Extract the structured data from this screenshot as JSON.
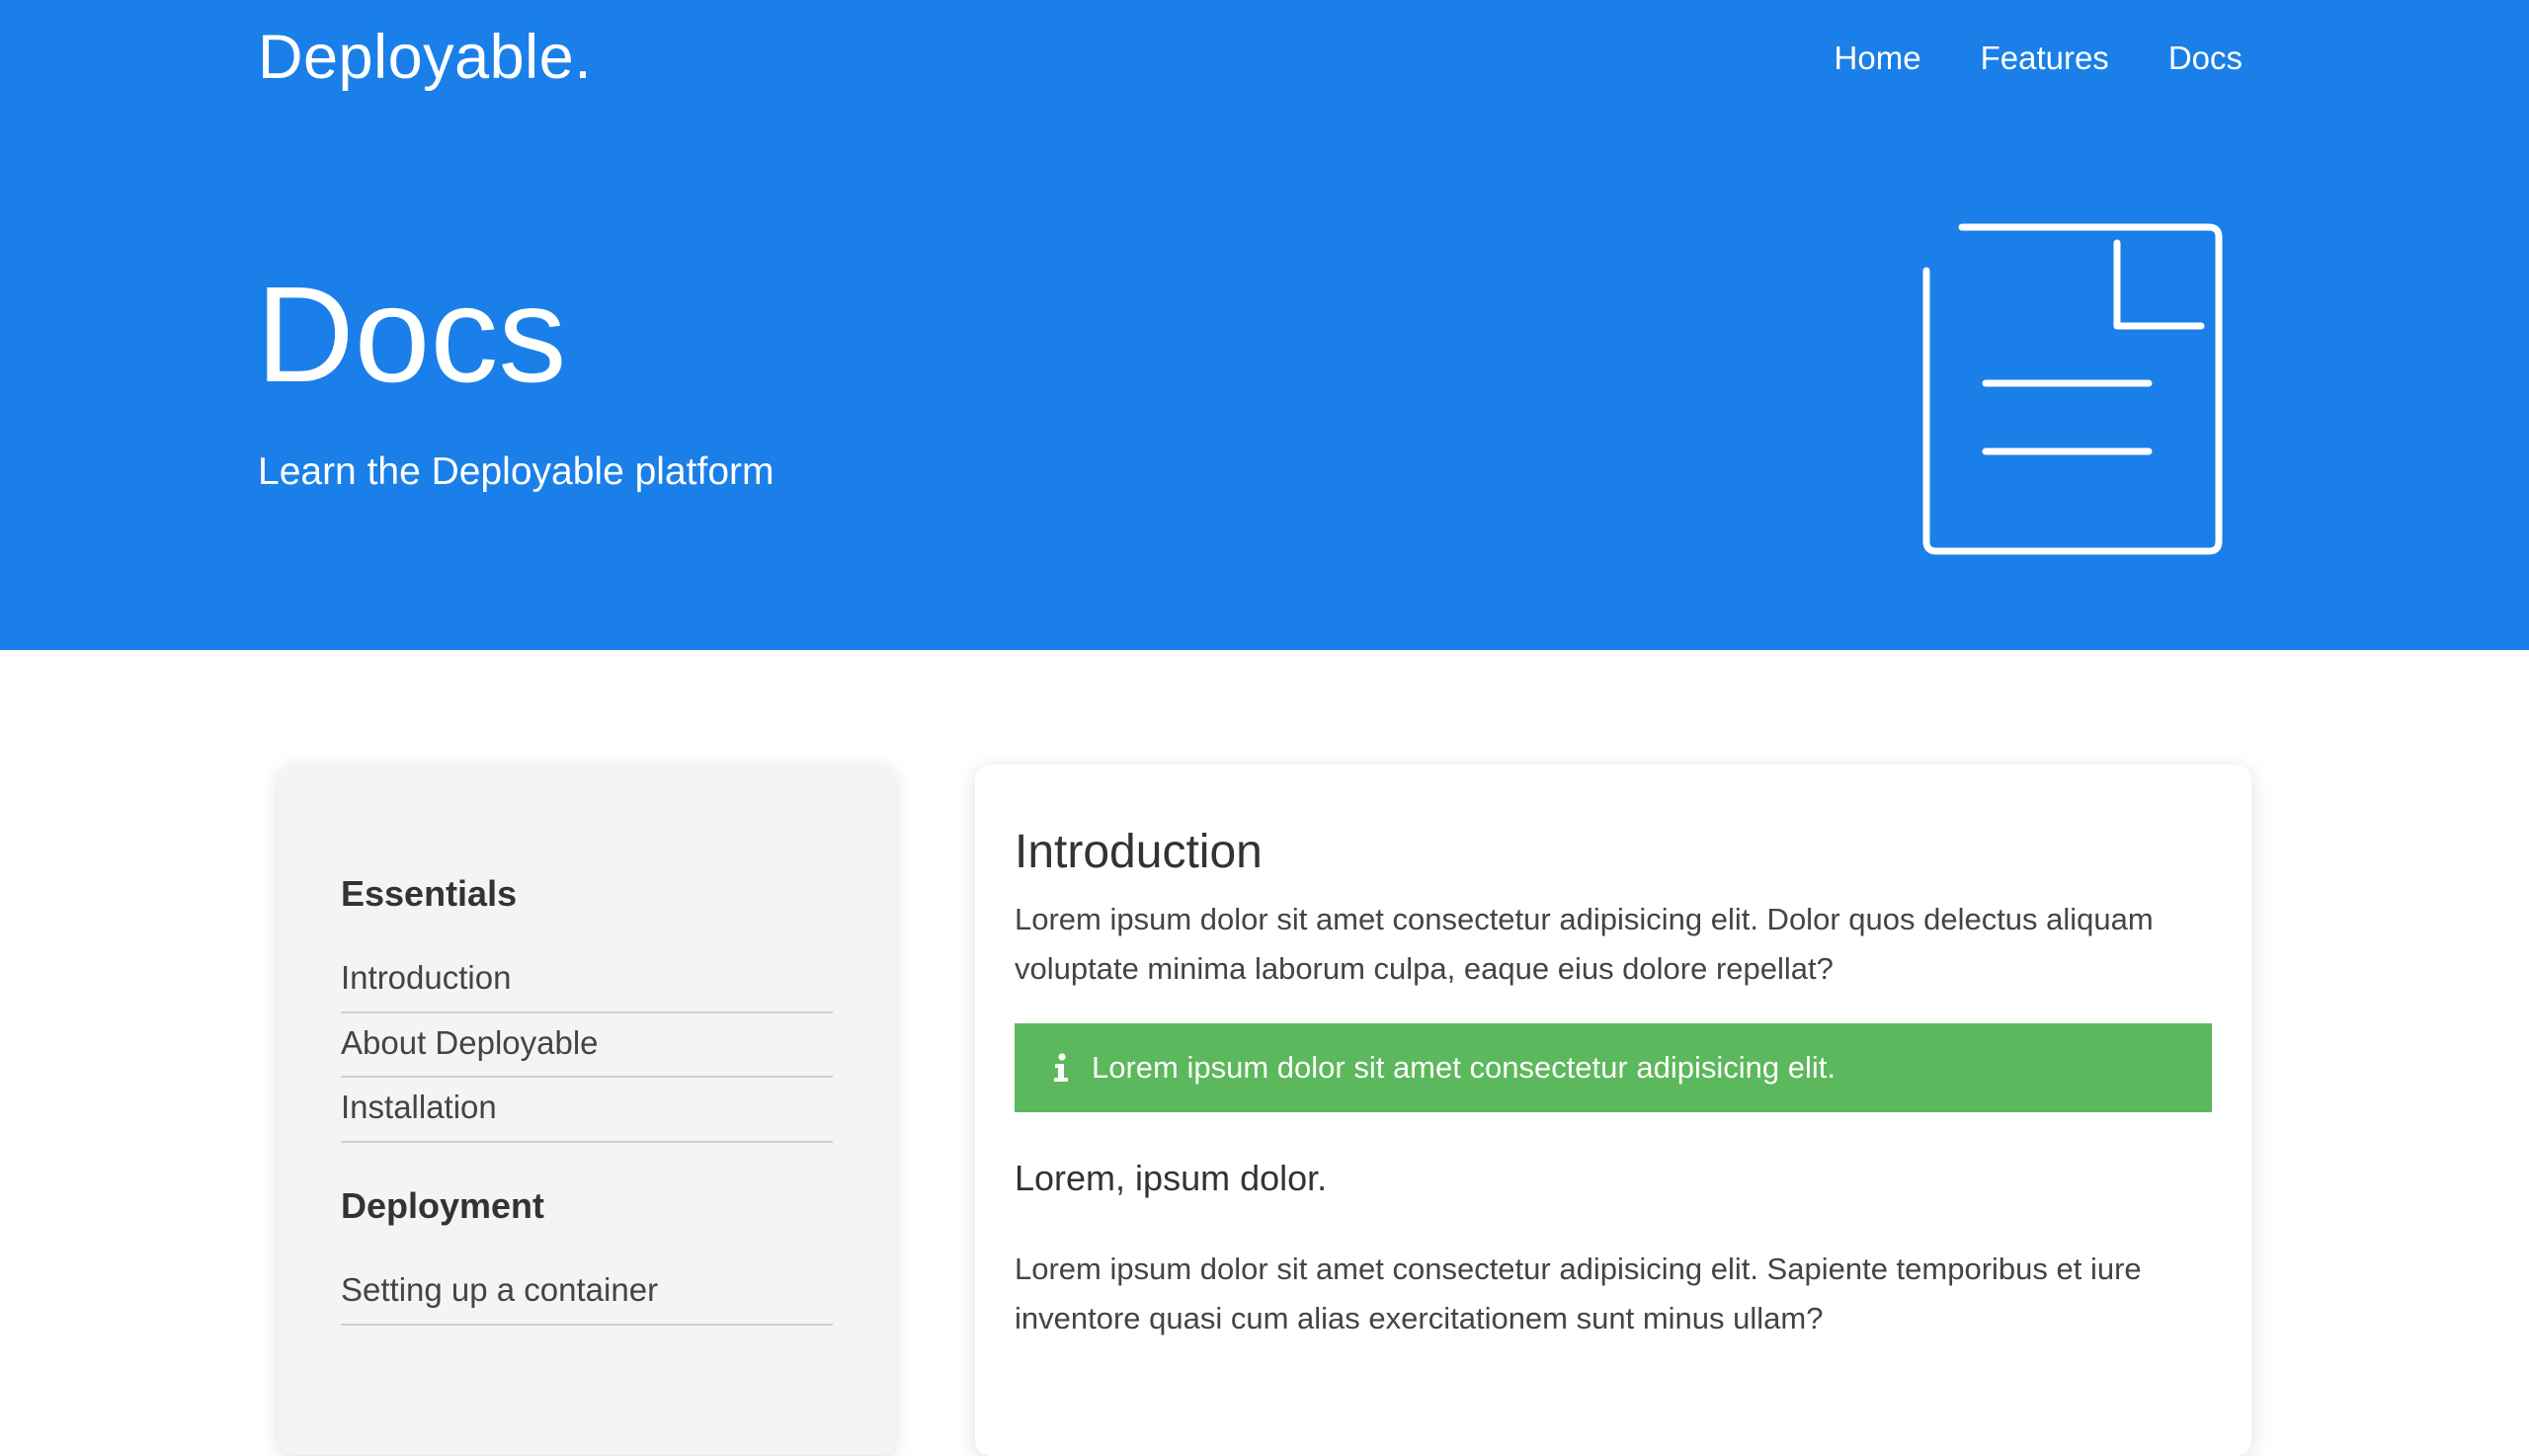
{
  "header": {
    "brand": "Deployable.",
    "nav": [
      "Home",
      "Features",
      "Docs"
    ]
  },
  "hero": {
    "title": "Docs",
    "subtitle": "Learn the Deployable platform",
    "icon": "document-icon"
  },
  "sidebar": {
    "sections": [
      {
        "heading": "Essentials",
        "items": [
          "Introduction",
          "About Deployable",
          "Installation"
        ]
      },
      {
        "heading": "Deployment",
        "items": [
          "Setting up a container"
        ]
      }
    ]
  },
  "main": {
    "title": "Introduction",
    "intro": "Lorem ipsum dolor sit amet consectetur adipisicing elit. Dolor quos delectus aliquam voluptate minima laborum culpa, eaque eius dolore repellat?",
    "alert": {
      "icon": "info-icon",
      "text": "Lorem ipsum dolor sit amet consectetur adipisicing elit."
    },
    "subheading": "Lorem, ipsum dolor.",
    "paragraph": "Lorem ipsum dolor sit amet consectetur adipisicing elit. Sapiente temporibus et iure inventore quasi cum alias exercitationem sunt minus ullam?"
  },
  "colors": {
    "primary": "#1a7fe8",
    "success": "#5cb85c",
    "sidebar_bg": "#f4f4f4"
  }
}
